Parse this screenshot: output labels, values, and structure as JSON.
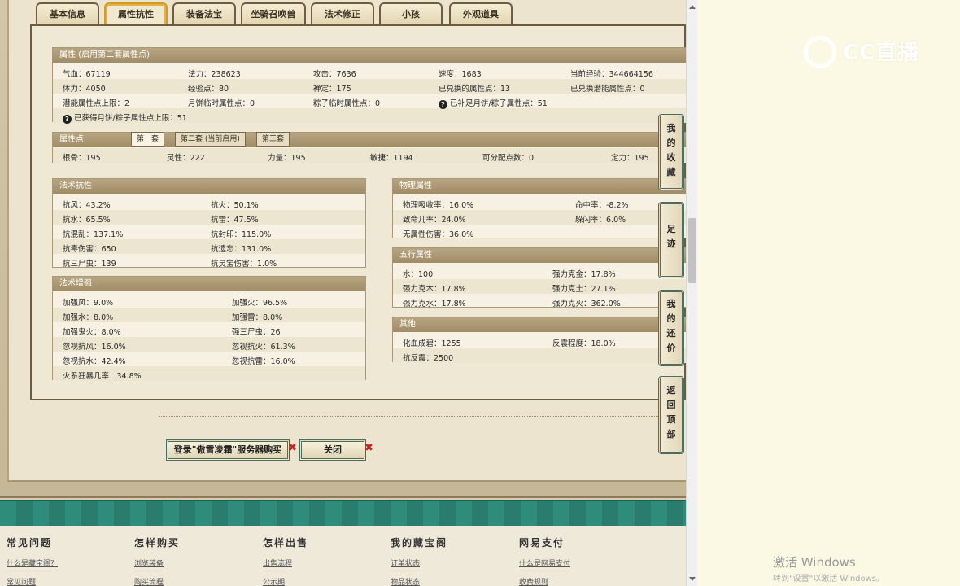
{
  "tabs": [
    "基本信息",
    "属性抗性",
    "装备法宝",
    "坐骑召唤兽",
    "法术修正",
    "小孩",
    "外观道具"
  ],
  "attributes": {
    "title": "属性 (启用第二套属性点)",
    "rows": [
      [
        "气血：67119",
        "法力：238623",
        "攻击：7636",
        "速度：1683",
        "当前经验：344664156"
      ],
      [
        "体力：4050",
        "经验点：80",
        "禅定：175",
        "已兑换的属性点：13",
        "已兑换潜能属性点：0"
      ],
      [
        "潜能属性点上限：2",
        "月饼临时属性点：0",
        "粽子临时属性点：0",
        "已补足月饼/粽子属性点：51",
        ""
      ]
    ],
    "help_note_1": "已补足月饼/粽子属性点：51",
    "last_line": "已获得月饼/粽子属性点上限：51"
  },
  "points": {
    "title": "属性点",
    "subtabs": [
      "第一套",
      "第二套 (当前启用)",
      "第三套"
    ],
    "values": [
      "根骨：195",
      "灵性：222",
      "力量：195",
      "敏捷：1194",
      "可分配点数：0",
      "定力：195"
    ]
  },
  "spell_resist": {
    "title": "法术抗性",
    "rows": [
      [
        "抗风：43.2%",
        "抗火：50.1%"
      ],
      [
        "抗水：65.5%",
        "抗雷：47.5%"
      ],
      [
        "抗混乱：137.1%",
        "抗封印：115.0%"
      ],
      [
        "抗毒伤害：650",
        "抗遗忘：131.0%"
      ],
      [
        "抗三尸虫：139",
        "抗灵宝伤害：1.0%"
      ]
    ]
  },
  "spell_boost": {
    "title": "法术增强",
    "rows": [
      [
        "加强风：9.0%",
        "加强火：96.5%"
      ],
      [
        "加强水：8.0%",
        "加强雷：8.0%"
      ],
      [
        "加强鬼火：8.0%",
        "强三尸虫：26"
      ],
      [
        "忽视抗风：16.0%",
        "忽视抗火：61.3%"
      ],
      [
        "忽视抗水：42.4%",
        "忽视抗雷：16.0%"
      ],
      [
        "火系狂暴几率：34.8%",
        ""
      ]
    ]
  },
  "physical": {
    "title": "物理属性",
    "rows": [
      [
        "物理吸收率：16.0%",
        "命中率：-8.2%"
      ],
      [
        "致命几率：24.0%",
        "躲闪率：6.0%"
      ],
      [
        "无属性伤害：36.0%",
        ""
      ]
    ]
  },
  "elements": {
    "title": "五行属性",
    "rows": [
      [
        "水：100",
        "强力克金：17.8%"
      ],
      [
        "强力克木：17.8%",
        "强力克土：27.1%"
      ],
      [
        "强力克水：17.8%",
        "强力克火：362.0%"
      ]
    ]
  },
  "other": {
    "title": "其他",
    "rows": [
      [
        "化血成碧：1255",
        "反震程度：18.0%"
      ],
      [
        "抗反震：2500",
        ""
      ]
    ]
  },
  "buttons": {
    "login": "登录\"傲雪凌霜\"服务器购买",
    "close": "关闭"
  },
  "side": [
    "我的收藏",
    "足迹",
    "我的还价",
    "返回顶部"
  ],
  "footer": [
    {
      "title": "常见问题",
      "links": [
        "什么是藏宝阁？",
        "常见问题"
      ]
    },
    {
      "title": "怎样购买",
      "links": [
        "浏览装备",
        "购买流程"
      ]
    },
    {
      "title": "怎样出售",
      "links": [
        "出售流程",
        "公示期"
      ]
    },
    {
      "title": "我的藏宝阁",
      "links": [
        "订单状态",
        "物品状态"
      ]
    },
    {
      "title": "网易支付",
      "links": [
        "什么是网易支付",
        "收费规则"
      ]
    }
  ],
  "overlay": {
    "logo_text": "CC直播",
    "windows_title": "激活 Windows",
    "windows_sub": "转到\"设置\"以激活 Windows。"
  },
  "colors": {
    "accent_teal": "#2f8b7a",
    "active_tab_border": "#d59a23",
    "box_title": "#a99875"
  }
}
